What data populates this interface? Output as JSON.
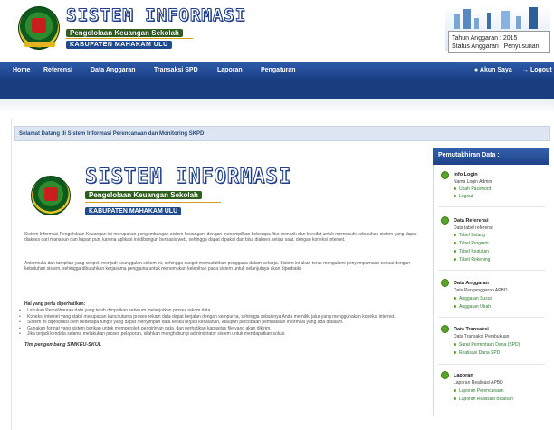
{
  "header": {
    "title": "SISTEM INFORMASI",
    "subtitle": "Pengelolaan Keuangan Sekolah",
    "kabupaten": "KABUPATEN MAHAKAM ULU",
    "tahun_anggaran": "Tahun Anggaran : 2015",
    "status_anggaran": "Status Anggaran : Penyusunan"
  },
  "nav": {
    "items": [
      "Home",
      "Referensi",
      "Data Anggaran",
      "Transaksi SPD",
      "Laporan",
      "Pengaturan"
    ],
    "account": "Akun Saya",
    "logout": "Logout"
  },
  "welcome": "Selamat Datang di Sistem Informasi Perencanaan dan Monitoring SKPD",
  "main": {
    "title": "SISTEM INFORMASI",
    "subtitle": "Pengelolaan Keuangan Sekolah",
    "kabupaten": "KABUPATEN MAHAKAM ULU",
    "paragraph1": "Sistem Informasi Pengelolaan Keuangan ini merupakan pengembangan sistem keuangan, dengan menampilkan beberapa fitur menarik dan bersifat untuk memenuhi kebutuhan sistem yang dapat diakses dari manapun dan kapan pun, karena aplikasi ini dibangun berbasis web, sehingga dapat dipakai dan bisa diakses setiap saat, dengan koneksi internet.",
    "paragraph2": "Antarmuka dan tampilan yang simpel, menjadi keunggulan sistem ini, sehingga sangat memudahkan pengguna dalam bekerja. Sistem ini akan terus mengalami penyempurnaan sesuai dengan kebutuhan sistem, sehingga dibutuhkan kerjasama pengguna untuk menemukan kelebihan pada sistem untuk selanjutnya akan diperbaiki.",
    "note_heading": "Hal yang perlu diperhatikan:",
    "notes": [
      "Lakukan Pemeliharaan data yang telah diinputkan sebelum melanjutkan proses rekam data.",
      "Koneksi internet yang stabil merupakan kunci utama proses rekam data dapat berjalan dengan sempurna, sehingga sebaiknya Anda memiliki jalur yang menggunakan koneksi internet.",
      "Sistem ini diproduksi oleh beberapa fungsi yang dapat menyimpan data ketika terjadi kesalahan, ataupun percobaan pembatalan informasi yang ada didalam.",
      "Gunakan format yang sistem berikan untuk memperoleh pengiriman data, dan perhatikan kapasitas file yang akan dikirim.",
      "Jika terjadi kendala selama melakukan proses pelaporan, silahkan menghubungi administrator sistem untuk mendapatkan solusi."
    ],
    "signoff": "Tim pengembang SIMKEU-SKUL"
  },
  "sidebar": {
    "header": "Pemutakhiran Data :",
    "sections": [
      {
        "title": "Info Login",
        "desc": "Nama Login Admin",
        "links": [
          "Ubah Password",
          "Logout"
        ]
      },
      {
        "title": "Data Referensi",
        "desc": "Data tabel referensi",
        "links": [
          "Tabel Bidang",
          "Tabel Program",
          "Tabel Kegiatan",
          "Tabel Rekening"
        ]
      },
      {
        "title": "Data Anggaran",
        "desc": "Data Penganggaran APBD",
        "links": [
          "Anggaran Susun",
          "Anggaran Ubah"
        ]
      },
      {
        "title": "Data Transaksi",
        "desc": "Data Transaksi Pembukuan",
        "links": [
          "Surat Permintaan Dana (SPD)",
          "Realisasi Dana SPD"
        ]
      },
      {
        "title": "Laporan",
        "desc": "Laporan Realisasi APBD",
        "links": [
          "Laporan Perencanaan",
          "Laporan Realisasi Bulanan"
        ]
      }
    ]
  }
}
